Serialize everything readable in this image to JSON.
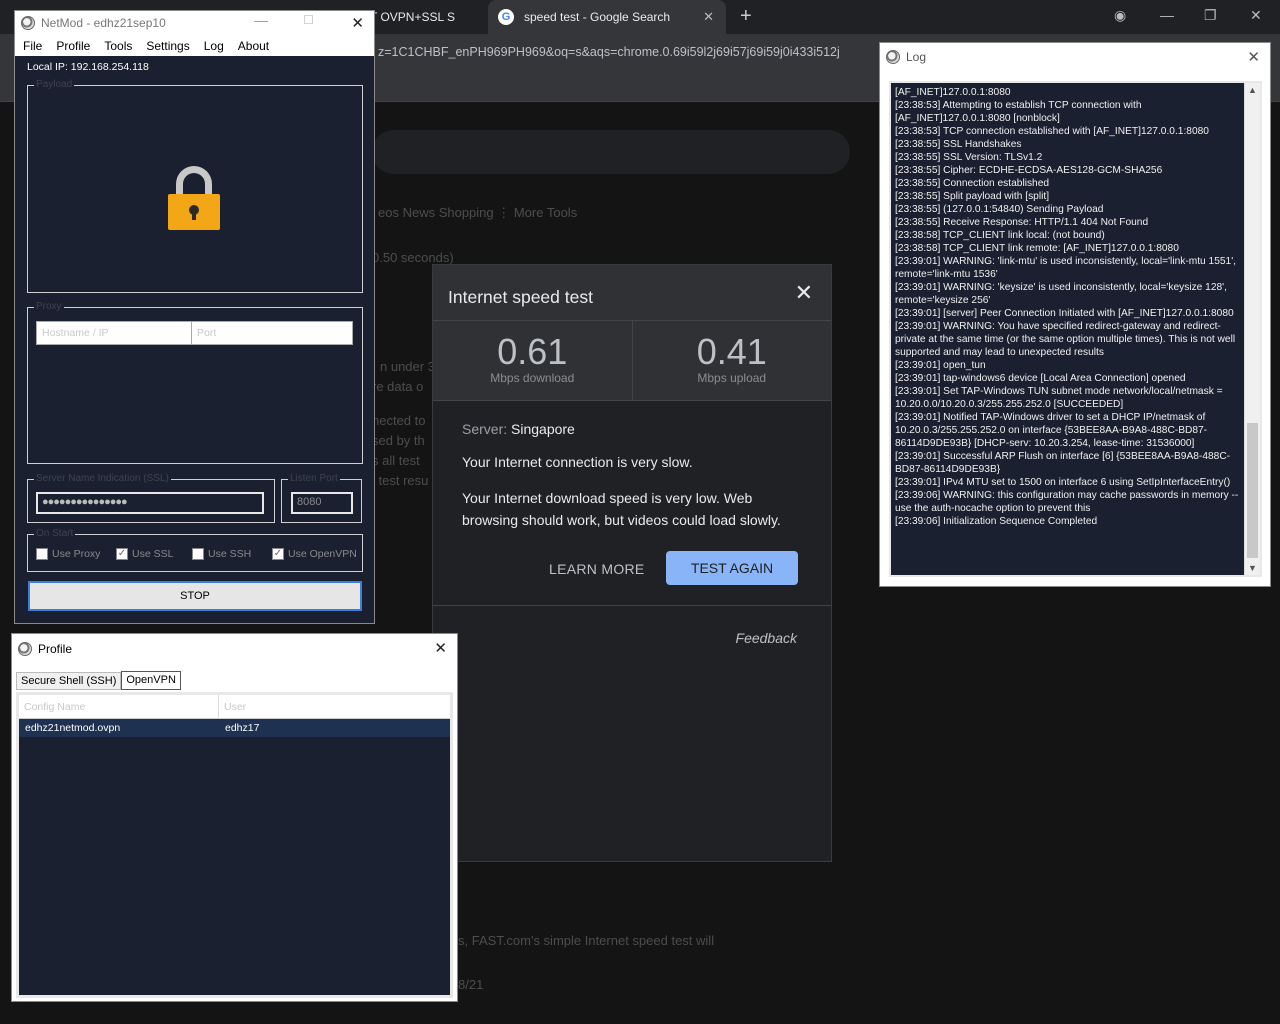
{
  "browser": {
    "inactive_tab_label": "ST OVPN+SSL S",
    "active_tab_label": "speed test - Google Search",
    "tab_close": "✕",
    "new_tab": "+",
    "omnibox": "z=1C1CHBF_enPH969PH969&oq=s&aqs=chrome.0.69i59l2j69i57j69i59j0i433i512j",
    "serp_tabs": "eos   News   Shopping   ⋮ More                                 Tools",
    "serp_stats": "0.50 seconds)",
    "serp_snippet_1": "n under 30",
    "serp_snippet_2": "re data o",
    "serp_snippet_3": "nected to",
    "serp_snippet_4": "sed by th",
    "serp_snippet_5": "s all test",
    "serp_snippet_6": "l test resu",
    "serp_bottom_1": "s, FAST.com's simple Internet speed test will",
    "serp_bottom_2": "8/21"
  },
  "speedtest": {
    "title": "Internet speed test",
    "close": "✕",
    "download_value": "0.61",
    "download_label": "Mbps download",
    "upload_value": "0.41",
    "upload_label": "Mbps upload",
    "server_label": "Server:",
    "server_value": "Singapore",
    "message_1": "Your Internet connection is very slow.",
    "message_2": "Your Internet download speed is very low. Web browsing should work, but videos could load slowly.",
    "learn_more": "LEARN MORE",
    "test_again": "TEST AGAIN",
    "feedback": "Feedback"
  },
  "netmod": {
    "title": "NetMod - edhz21sep10",
    "close": "✕",
    "menu": [
      "File",
      "Profile",
      "Tools",
      "Settings",
      "Log",
      "About"
    ],
    "local_ip": "Local IP: 192.168.254.118",
    "payload_label": "Payload",
    "proxy_label": "Proxy",
    "hostname_placeholder": "Hostname / IP",
    "port_placeholder": "Port",
    "sni_label": "Server Name Indication (SSL)",
    "sni_value": "●●●●●●●●●●●●●●●",
    "listen_port_label": "Listen Port",
    "listen_port_value": "8080",
    "on_start_label": "On Start",
    "checks": [
      {
        "label": "Use Proxy",
        "mark": ""
      },
      {
        "label": "Use SSL",
        "mark": "✓"
      },
      {
        "label": "Use SSH",
        "mark": ""
      },
      {
        "label": "Use OpenVPN",
        "mark": "✓"
      }
    ],
    "stop_label": "STOP"
  },
  "profile": {
    "title": "Profile",
    "close": "✕",
    "tabs": [
      "Secure Shell (SSH)",
      "OpenVPN"
    ],
    "columns": [
      "Config Name",
      "User"
    ],
    "rows": [
      {
        "config": "edhz21netmod.ovpn",
        "user": "edhz17"
      }
    ]
  },
  "log": {
    "title": "Log",
    "close": "✕",
    "lines": [
      "[AF_INET]127.0.0.1:8080",
      "[23:38:53] Attempting to establish TCP connection with [AF_INET]127.0.0.1:8080 [nonblock]",
      "[23:38:53] TCP connection established with [AF_INET]127.0.0.1:8080",
      "[23:38:55] SSL Handshakes",
      "[23:38:55] SSL Version: TLSv1.2",
      "[23:38:55] Cipher: ECDHE-ECDSA-AES128-GCM-SHA256",
      "[23:38:55] Connection established",
      "[23:38:55] Split payload with [split]",
      "[23:38:55] (127.0.0.1:54840) Sending Payload",
      "[23:38:55] Receive Response: HTTP/1.1 404 Not Found",
      "[23:38:58] TCP_CLIENT link local: (not bound)",
      "[23:38:58] TCP_CLIENT link remote: [AF_INET]127.0.0.1:8080",
      "[23:39:01] WARNING: 'link-mtu' is used inconsistently, local='link-mtu 1551', remote='link-mtu 1536'",
      "[23:39:01] WARNING: 'keysize' is used inconsistently, local='keysize 128', remote='keysize 256'",
      "[23:39:01] [server] Peer Connection Initiated with [AF_INET]127.0.0.1:8080",
      "[23:39:01] WARNING: You have specified redirect-gateway and redirect-private at the same time (or the same option multiple times). This is not well supported and may lead to unexpected results",
      "[23:39:01] open_tun",
      "[23:39:01] tap-windows6 device [Local Area Connection] opened",
      "[23:39:01] Set TAP-Windows TUN subnet mode network/local/netmask = 10.20.0.0/10.20.0.3/255.255.252.0 [SUCCEEDED]",
      "[23:39:01] Notified TAP-Windows driver to set a DHCP IP/netmask of 10.20.0.3/255.255.252.0 on interface {53BEE8AA-B9A8-488C-BD87-86114D9DE93B} [DHCP-serv: 10.20.3.254, lease-time: 31536000]",
      "[23:39:01] Successful ARP Flush on interface [6] {53BEE8AA-B9A8-488C-BD87-86114D9DE93B}",
      "[23:39:01] IPv4 MTU set to 1500 on interface 6 using SetIpInterfaceEntry()",
      "[23:39:06] WARNING: this configuration may cache passwords in memory -- use the auth-nocache option to prevent this",
      "[23:39:06] Initialization Sequence Completed"
    ]
  }
}
